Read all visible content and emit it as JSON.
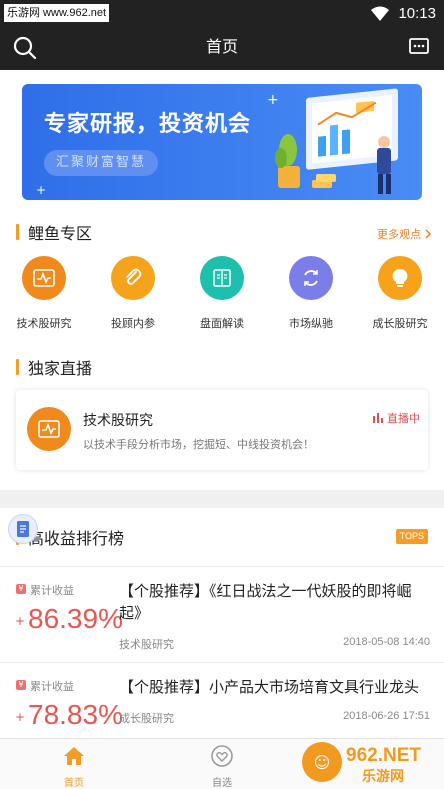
{
  "watermark_top": "乐游网 www.962.net",
  "status": {
    "time": "10:13"
  },
  "nav": {
    "title": "首页"
  },
  "banner": {
    "title": "专家研报，投资机会",
    "subtitle": "汇聚财富智慧"
  },
  "section_carp": {
    "title": "鲤鱼专区",
    "more": "更多观点",
    "items": [
      {
        "label": "技术股研究",
        "icon": "pulse-chart-icon",
        "color": "#f08a1c"
      },
      {
        "label": "投顾内参",
        "icon": "paperclip-icon",
        "color": "#f5a31a"
      },
      {
        "label": "盘面解读",
        "icon": "book-icon",
        "color": "#1fbfae"
      },
      {
        "label": "市场纵驰",
        "icon": "refresh-icon",
        "color": "#7b7ee8"
      },
      {
        "label": "成长股研究",
        "icon": "lightbulb-icon",
        "color": "#f6a21b"
      }
    ]
  },
  "section_live": {
    "title": "独家直播",
    "card": {
      "name": "技术股研究",
      "desc": "以技术手段分析市场，挖掘短、中线投资机会！",
      "badge": "直播中",
      "icon": "pulse-chart-icon"
    }
  },
  "section_rank": {
    "title": "高收益排行榜",
    "tag": "TOPS",
    "items": [
      {
        "yield_label": "累计收益",
        "plus": "+",
        "yield": "86.39%",
        "title": "【个股推荐】《红日战法之一代妖股的即将崛起》",
        "category": "技术股研究",
        "date": "2018-05-08 14:40"
      },
      {
        "yield_label": "累计收益",
        "plus": "+",
        "yield": "78.83%",
        "title": "【个股推荐】小产品大市场培育文具行业龙头",
        "category": "成长股研究",
        "date": "2018-06-26 17:51"
      }
    ]
  },
  "tabbar": {
    "items": [
      {
        "label": "首页",
        "icon": "home-icon",
        "active": true
      },
      {
        "label": "自选",
        "icon": "heart-icon",
        "active": false
      }
    ]
  },
  "watermark_bottom": {
    "brand": "962.NET",
    "text": "乐游网"
  },
  "colors": {
    "accent": "#f39c2a",
    "red": "#e5574f",
    "nav_bg": "#222222"
  }
}
